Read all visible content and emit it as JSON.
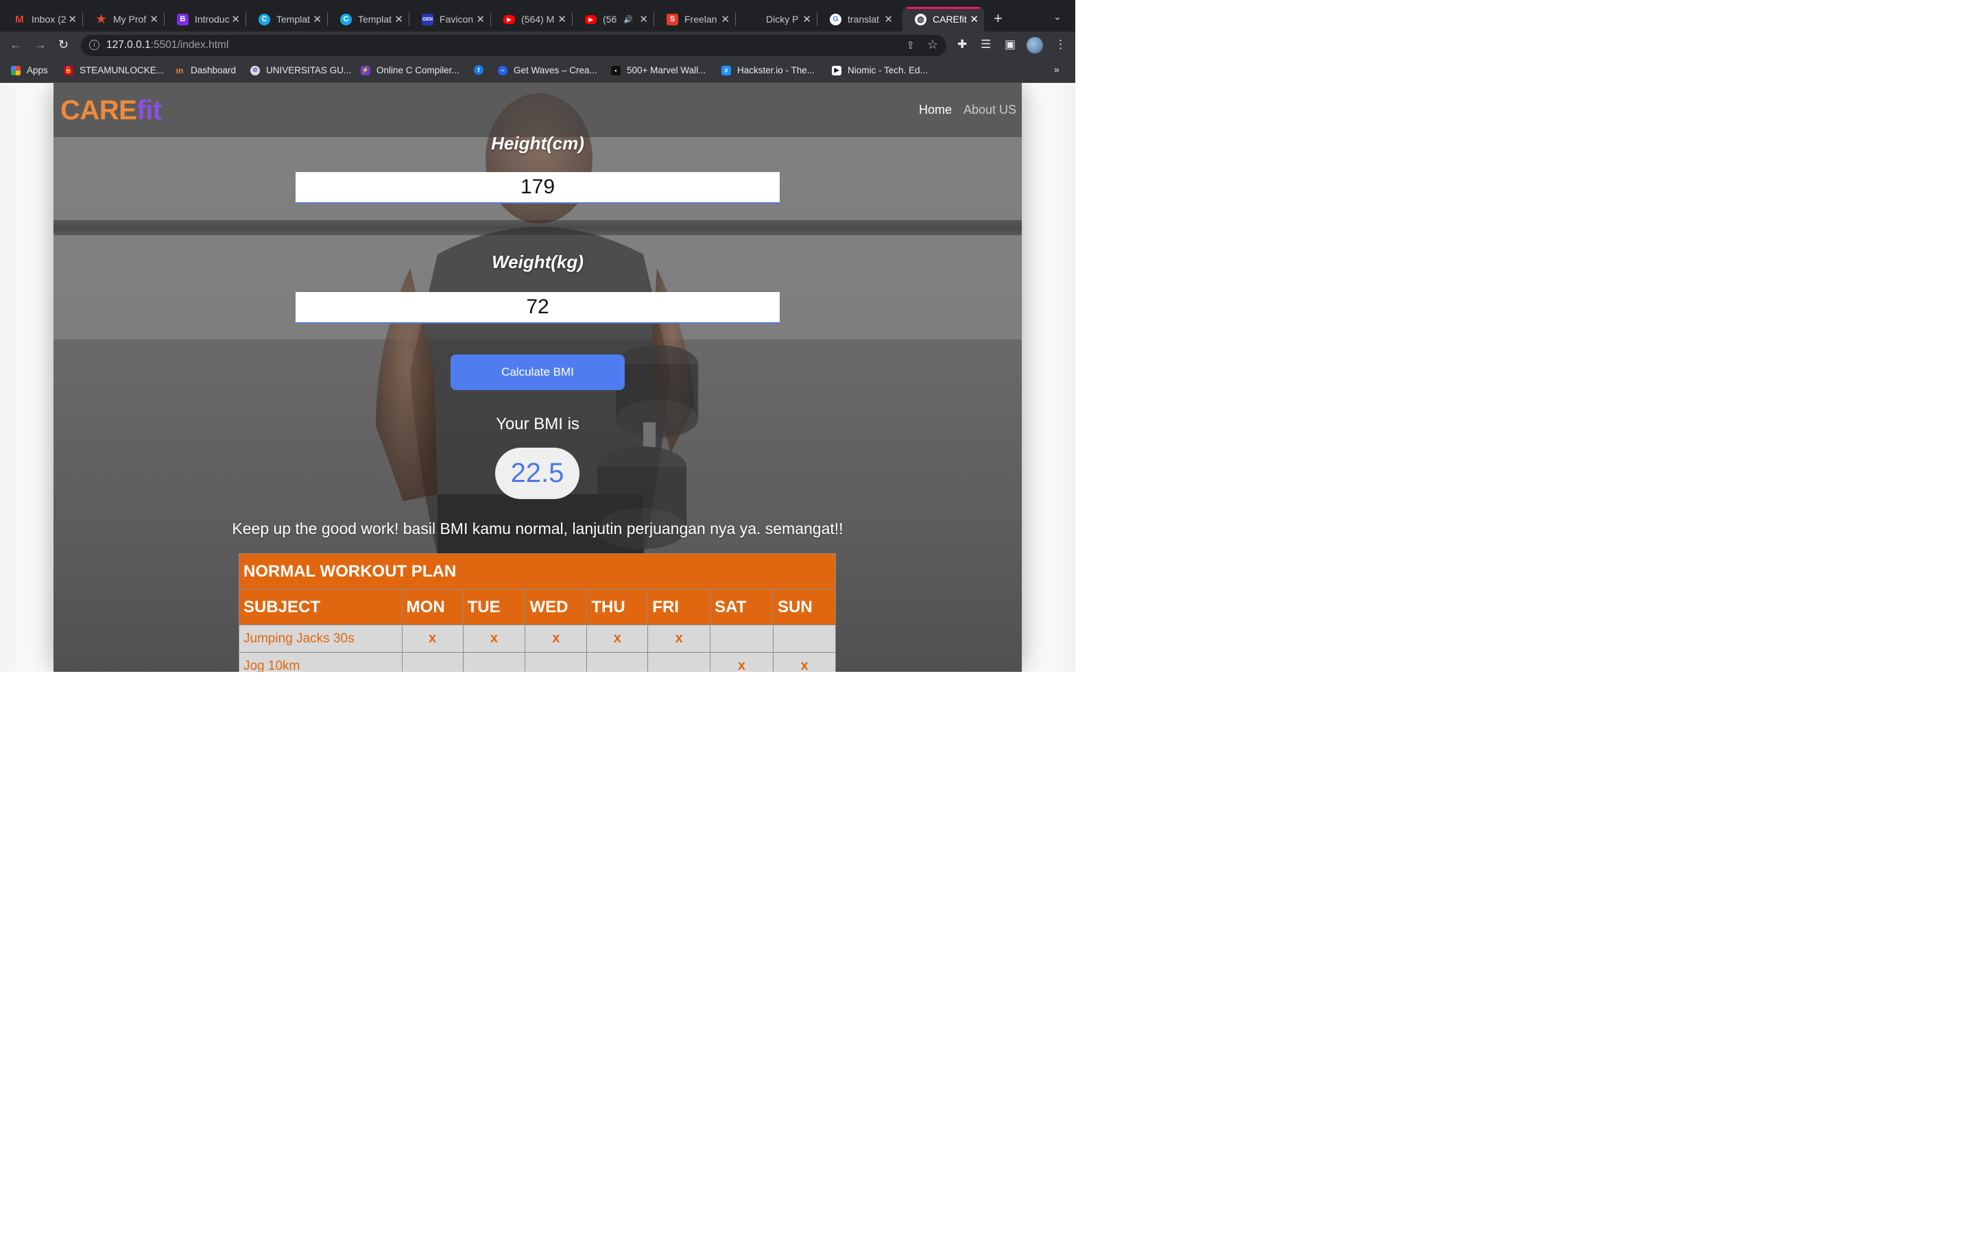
{
  "browser": {
    "tabs": [
      {
        "title": "Inbox (2",
        "favicon": "gmail-icon",
        "color": "#ea4335"
      },
      {
        "title": "My Prof",
        "favicon": "star-icon",
        "color": "#e04a2f"
      },
      {
        "title": "Introduc",
        "favicon": "bootstrap-icon",
        "color": "#7b2fe0"
      },
      {
        "title": "Templat",
        "favicon": "canva-icon",
        "color": "#1aa6e8"
      },
      {
        "title": "Templat",
        "favicon": "canva-icon",
        "color": "#1aa6e8"
      },
      {
        "title": "Favicon",
        "favicon": "favicon-generator-icon",
        "color": "#2a36b8"
      },
      {
        "title": "(564) M",
        "favicon": "youtube-icon",
        "color": "#ff0000"
      },
      {
        "title": "(56",
        "favicon": "youtube-icon",
        "color": "#ff0000"
      },
      {
        "title": "Freelan",
        "favicon": "sribulancer-icon",
        "color": "#e23c2c"
      },
      {
        "title": "Dicky P",
        "favicon": "github-icon",
        "color": "#202124"
      },
      {
        "title": "translat",
        "favicon": "google-icon",
        "color": "#ffffff"
      },
      {
        "title": "CAREfit",
        "favicon": "globe-icon",
        "color": "#ffffff"
      }
    ],
    "url_host": "127.0.0.1",
    "url_path": ":5501/index.html",
    "bookmarks": [
      {
        "label": "Apps",
        "icon": "apps-grid-icon",
        "color": "#e94235"
      },
      {
        "label": "STEAMUNLOCKE...",
        "icon": "steamunlocked-icon",
        "color": "#d0021b"
      },
      {
        "label": "Dashboard",
        "icon": "dashboard-icon",
        "color": "#f08a3c"
      },
      {
        "label": "UNIVERSITAS GU...",
        "icon": "university-icon",
        "color": "#6a5acd"
      },
      {
        "label": "Online C Compiler...",
        "icon": "compiler-icon",
        "color": "#6c3fc4"
      },
      {
        "label": "",
        "icon": "facebook-icon",
        "color": "#1877f2"
      },
      {
        "label": "Get Waves – Crea...",
        "icon": "waves-icon",
        "color": "#2563eb"
      },
      {
        "label": "500+ Marvel Wall...",
        "icon": "marvel-icon",
        "color": "#111111"
      },
      {
        "label": "Hackster.io - The...",
        "icon": "hackster-icon",
        "color": "#1e90ff"
      },
      {
        "label": "Niomic - Tech. Ed...",
        "icon": "niomic-icon",
        "color": "#ffffff"
      }
    ],
    "more": "»"
  },
  "site": {
    "logo_a": "CARE",
    "logo_b": "fit",
    "nav_home": "Home",
    "nav_about": "About US",
    "height_label": "Height(cm)",
    "height_value": "179",
    "weight_label": "Weight(kg)",
    "weight_value": "72",
    "calc_button": "Calculate BMI",
    "bmi_title": "Your BMI is",
    "bmi_value": "22.5",
    "bmi_message": "Keep up the good work! basil BMI kamu normal, lanjutin perjuangan nya ya. semangat!!",
    "colors": {
      "logo_a": "#f08a3c",
      "logo_b": "#8e4fe0",
      "accent": "#4f7df0",
      "table": "#e06710"
    }
  },
  "plan": {
    "title": "NORMAL WORKOUT PLAN",
    "headers": [
      "SUBJECT",
      "MON",
      "TUE",
      "WED",
      "THU",
      "FRI",
      "SAT",
      "SUN"
    ],
    "rows": [
      {
        "subject": "Jumping Jacks 30s",
        "marks": [
          "x",
          "x",
          "x",
          "x",
          "x",
          "",
          ""
        ]
      },
      {
        "subject": "Jog 10km",
        "marks": [
          "",
          "",
          "",
          "",
          "",
          "x",
          "x"
        ]
      }
    ]
  }
}
